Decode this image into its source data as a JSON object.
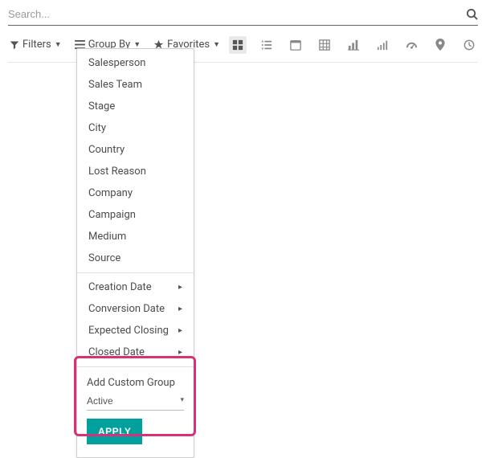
{
  "search": {
    "placeholder": "Search..."
  },
  "toolbar": {
    "filters_label": "Filters",
    "groupby_label": "Group By",
    "favorites_label": "Favorites"
  },
  "views": {
    "active": "kanban"
  },
  "groupby_menu": {
    "simple": [
      "Salesperson",
      "Sales Team",
      "Stage",
      "City",
      "Country",
      "Lost Reason",
      "Company",
      "Campaign",
      "Medium",
      "Source"
    ],
    "dates": [
      "Creation Date",
      "Conversion Date",
      "Expected Closing",
      "Closed Date"
    ],
    "custom_title": "Add Custom Group",
    "custom_selected": "Active",
    "apply_label": "APPLY"
  }
}
